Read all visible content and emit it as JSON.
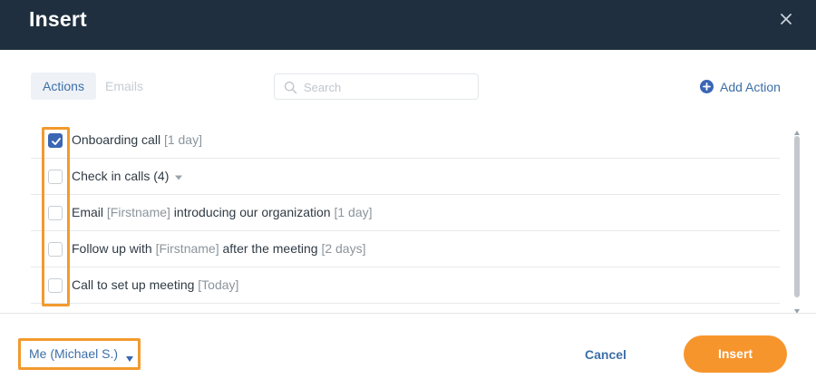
{
  "dialog": {
    "title": "Insert",
    "close_icon": "close-icon"
  },
  "toolbar": {
    "tabs": [
      {
        "label": "Actions",
        "active": true
      },
      {
        "label": "Emails",
        "active": false
      }
    ],
    "search": {
      "placeholder": "Search",
      "value": "",
      "icon": "search-icon"
    },
    "add_action": {
      "label": "Add Action",
      "icon": "plus-circle-icon"
    }
  },
  "actions": [
    {
      "checked": true,
      "parts": [
        {
          "text": "Onboarding call ",
          "muted": false
        },
        {
          "text": "[1 day]",
          "muted": true
        }
      ]
    },
    {
      "checked": false,
      "has_dropdown": true,
      "parts": [
        {
          "text": "Check in calls (4)",
          "muted": false
        }
      ]
    },
    {
      "checked": false,
      "parts": [
        {
          "text": "Email ",
          "muted": false
        },
        {
          "text": "[Firstname]",
          "muted": true
        },
        {
          "text": " introducing our organization ",
          "muted": false
        },
        {
          "text": "[1 day]",
          "muted": true
        }
      ]
    },
    {
      "checked": false,
      "parts": [
        {
          "text": "Follow up with ",
          "muted": false
        },
        {
          "text": "[Firstname]",
          "muted": true
        },
        {
          "text": " after the meeting ",
          "muted": false
        },
        {
          "text": "[2 days]",
          "muted": true
        }
      ]
    },
    {
      "checked": false,
      "parts": [
        {
          "text": "Call to set up meeting ",
          "muted": false
        },
        {
          "text": "[Today]",
          "muted": true
        }
      ]
    }
  ],
  "footer": {
    "owner_label": "Me (Michael S.)",
    "cancel_label": "Cancel",
    "insert_label": "Insert"
  },
  "colors": {
    "header_bg": "#1f2f3f",
    "accent_blue": "#3d6fa8",
    "checkbox_checked": "#3a66b4",
    "primary_orange": "#f7952d",
    "highlight_orange": "#f29a2e"
  }
}
